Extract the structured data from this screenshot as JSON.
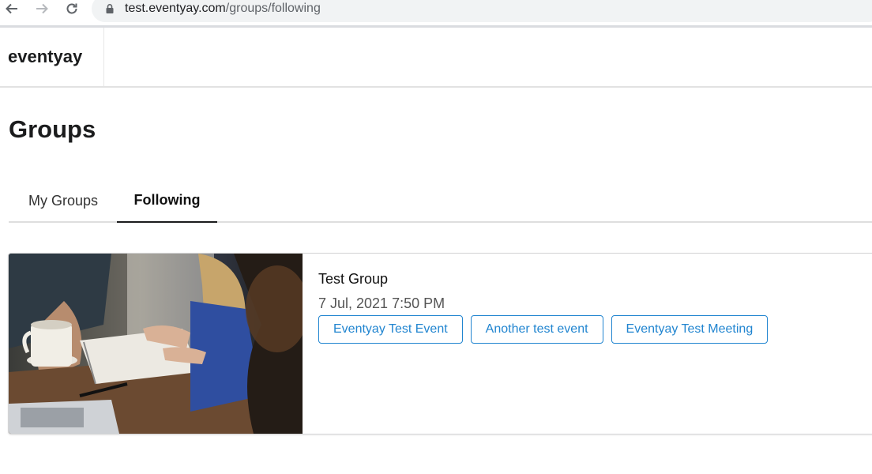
{
  "browser": {
    "url_host": "test.eventyay.com",
    "url_path": "/groups/following"
  },
  "header": {
    "brand": "eventyay"
  },
  "page": {
    "title": "Groups"
  },
  "tabs": [
    {
      "label": "My Groups",
      "active": false
    },
    {
      "label": "Following",
      "active": true
    }
  ],
  "groups": [
    {
      "name": "Test Group",
      "date": "7 Jul, 2021 7:50 PM",
      "events": [
        "Eventyay Test Event",
        "Another test event",
        "Eventyay Test Meeting"
      ]
    }
  ],
  "colors": {
    "accent": "#2185d0",
    "tab_underline": "#1b1c1d"
  }
}
